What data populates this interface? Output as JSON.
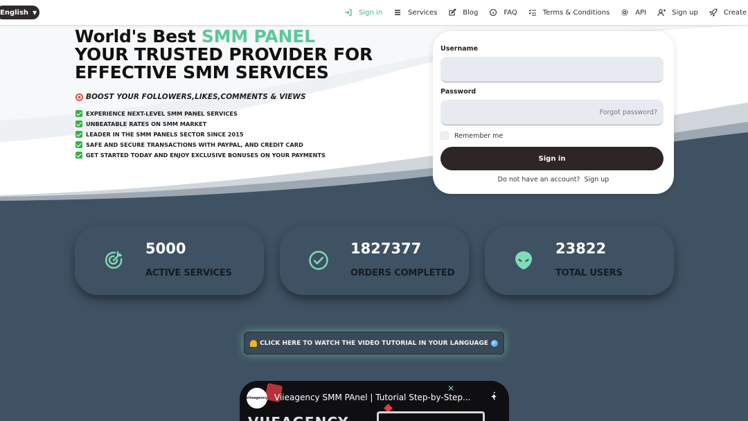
{
  "topbar": {
    "language": "English",
    "nav": [
      {
        "label": "Sign in",
        "icon": "sign-in-icon",
        "active": true
      },
      {
        "label": "Services",
        "icon": "list-icon"
      },
      {
        "label": "Blog",
        "icon": "edit-icon"
      },
      {
        "label": "FAQ",
        "icon": "info-icon"
      },
      {
        "label": "Terms & Conditions",
        "icon": "checklist-icon"
      },
      {
        "label": "API",
        "icon": "gear-icon"
      },
      {
        "label": "Sign up",
        "icon": "user-plus-icon"
      },
      {
        "label": "Create Your",
        "icon": "rocket-icon"
      }
    ]
  },
  "hero": {
    "title_prefix": "World's Best ",
    "title_accent": "SMM PANEL",
    "title_line2": "YOUR TRUSTED PROVIDER FOR",
    "title_line3": "EFFECTIVE SMM SERVICES",
    "subtitle": "BOOST YOUR FOLLOWERS,LIKES,COMMENTS & VIEWS",
    "features": [
      "EXPERIENCE NEXT-LEVEL SMM PANEL SERVICES",
      "UNBEATABLE RATES ON SMM MARKET",
      "LEADER IN THE SMM PANELS SECTOR SINCE 2015",
      "SAFE AND SECURE TRANSACTIONS WITH PAYPAL, AND CREDIT CARD",
      "GET STARTED TODAY AND ENJOY EXCLUSIVE BONUSES ON YOUR PAYMENTS"
    ]
  },
  "login": {
    "username_label": "Username",
    "username_value": "",
    "password_label": "Password",
    "password_value": "",
    "forgot": "Forgot password?",
    "remember": "Remember me",
    "signin_button": "Sign in",
    "no_account": "Do not have an account?",
    "signup_link": "Sign up"
  },
  "stats": [
    {
      "value": "5000",
      "label": "ACTIVE SERVICES",
      "icon": "target-icon"
    },
    {
      "value": "1827377",
      "label": "ORDERS COMPLETED",
      "icon": "check-circle-icon"
    },
    {
      "value": "23822",
      "label": "TOTAL USERS",
      "icon": "alien-icon"
    }
  ],
  "video_button": "CLICK HERE TO WATCH THE VIDEO TUTORIAL IN YOUR LANGUAGE",
  "video": {
    "channel": "viieagency",
    "title": "Viieagency SMM PAnel | Tutorial Step-by-Step...",
    "brand": "VIIEAGENCY"
  },
  "colors": {
    "accent": "#5ac997",
    "dark": "#2e2624",
    "section_bg": "#3f5263",
    "icon_teal": "#7fdcb5"
  }
}
